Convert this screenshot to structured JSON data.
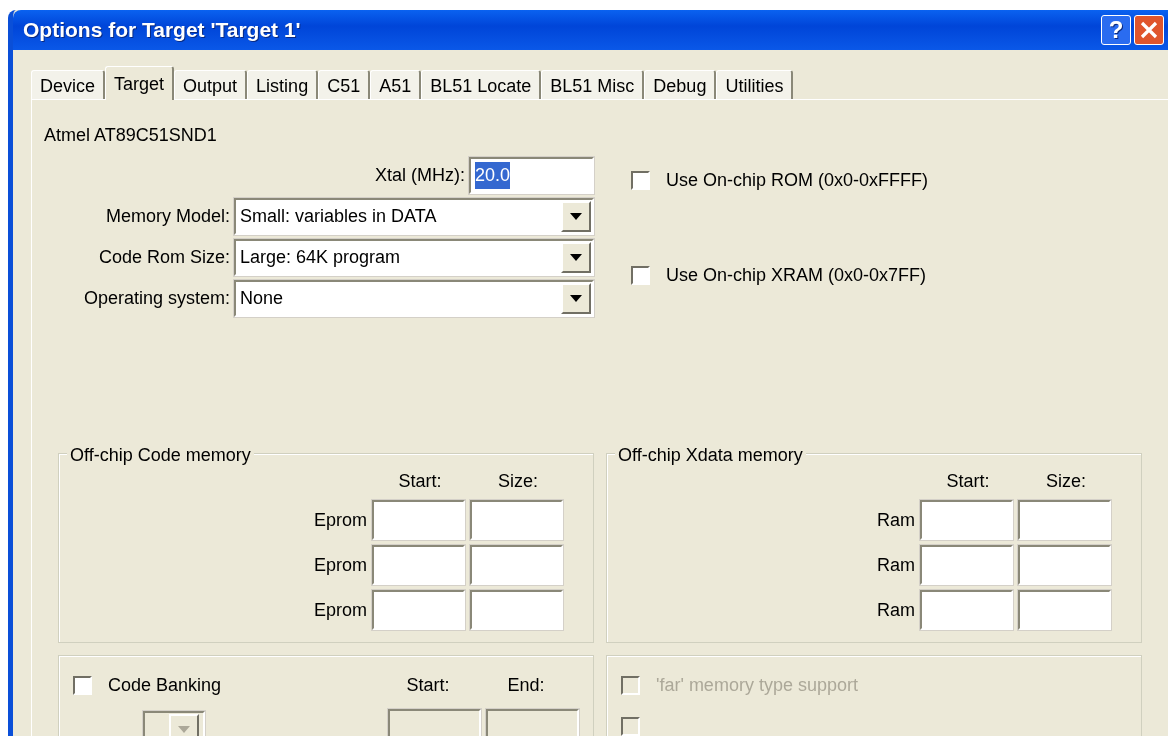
{
  "window": {
    "title": "Options for Target 'Target 1'",
    "help": "?"
  },
  "tabs": [
    {
      "label": "Device",
      "selected": false
    },
    {
      "label": "Target",
      "selected": true
    },
    {
      "label": "Output",
      "selected": false
    },
    {
      "label": "Listing",
      "selected": false
    },
    {
      "label": "C51",
      "selected": false
    },
    {
      "label": "A51",
      "selected": false
    },
    {
      "label": "BL51 Locate",
      "selected": false
    },
    {
      "label": "BL51 Misc",
      "selected": false
    },
    {
      "label": "Debug",
      "selected": false
    },
    {
      "label": "Utilities",
      "selected": false
    }
  ],
  "device": "Atmel AT89C51SND1",
  "xtal": {
    "label": "Xtal (MHz):",
    "value": "20.0",
    "text_selected": true
  },
  "combos": [
    {
      "label": "Memory Model:",
      "value": "Small: variables in DATA"
    },
    {
      "label": "Code Rom Size:",
      "value": "Large: 64K program"
    },
    {
      "label": "Operating system:",
      "value": "None"
    }
  ],
  "onchip": [
    {
      "label": "Use On-chip ROM (0x0-0xFFFF)",
      "checked": false
    },
    {
      "label": "Use On-chip XRAM (0x0-0x7FF)",
      "checked": false
    }
  ],
  "groups": [
    {
      "title": "Off-chip Code memory",
      "columns": [
        "Start:",
        "Size:"
      ],
      "rows": [
        "Eprom",
        "Eprom",
        "Eprom"
      ]
    },
    {
      "title": "Off-chip Xdata memory",
      "columns": [
        "Start:",
        "Size:"
      ],
      "rows": [
        "Ram",
        "Ram",
        "Ram"
      ]
    }
  ],
  "banking": {
    "checkbox": {
      "label": "Code Banking",
      "checked": false
    },
    "columns": [
      "Start:",
      "End:"
    ],
    "disabled": true
  },
  "far_options": [
    {
      "label": "'far' memory type support",
      "checked": false,
      "disabled": true
    },
    {
      "checked": false,
      "disabled": true
    }
  ]
}
